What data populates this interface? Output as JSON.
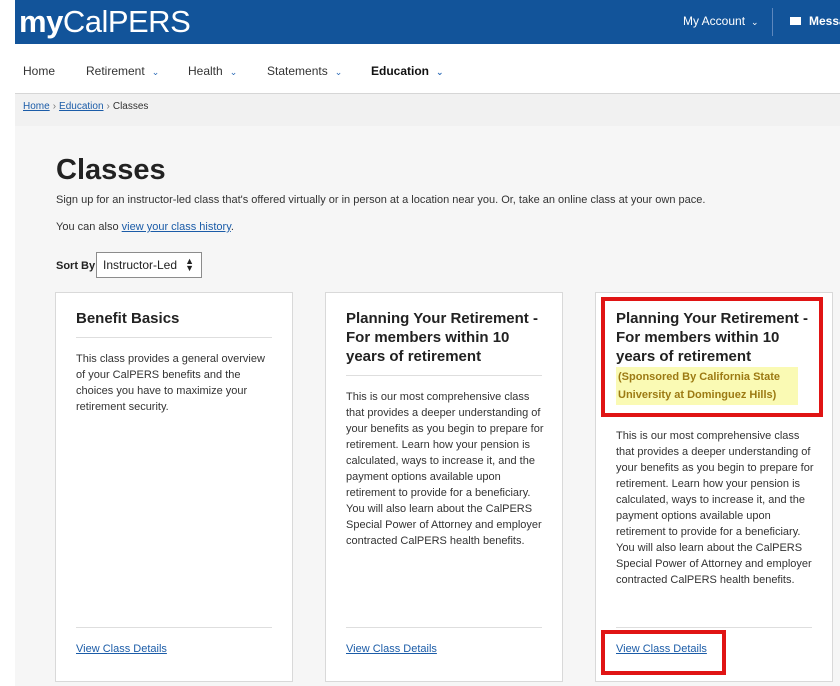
{
  "header": {
    "logo_my": "my",
    "logo_calpers": "CalPERS",
    "account_label": "My Account",
    "messages_label": "Messa"
  },
  "nav": {
    "items": [
      {
        "label": "Home",
        "has_dropdown": false
      },
      {
        "label": "Retirement",
        "has_dropdown": true
      },
      {
        "label": "Health",
        "has_dropdown": true
      },
      {
        "label": "Statements",
        "has_dropdown": true
      },
      {
        "label": "Education",
        "has_dropdown": true,
        "active": true
      }
    ]
  },
  "breadcrumb": {
    "items": [
      "Home",
      "Education",
      "Classes"
    ],
    "separator": "›"
  },
  "page": {
    "title": "Classes",
    "intro": "Sign up for an instructor-led class that's offered virtually or in person at a location near you. Or, take an online class at your own pace.",
    "history_prefix": "You can also ",
    "history_link": "view your class history",
    "history_suffix": "."
  },
  "sort": {
    "label": "Sort By",
    "selected": "Instructor-Led"
  },
  "cards": [
    {
      "title": "Benefit Basics",
      "description": "This class provides a general overview of your CalPERS benefits and the choices you have to maximize your retirement security.",
      "link": "View Class Details"
    },
    {
      "title": "Planning Your Retirement - For members within 10 years of retirement",
      "description": "This is our most comprehensive class that provides a deeper understanding of your benefits as you begin to prepare for retirement. Learn how your pension is calculated, ways to increase it, and the payment options available upon retirement to provide for a beneficiary. You will also learn about the CalPERS Special Power of Attorney and employer contracted CalPERS health benefits.",
      "link": "View Class Details"
    },
    {
      "title": "Planning Your Retirement - For members within 10 years of retirement",
      "sponsor": "(Sponsored By California State University at Dominguez Hills)",
      "description": "This is our most comprehensive class that provides a deeper understanding of your benefits as you begin to prepare for retirement. Learn how your pension is calculated, ways to increase it, and the payment options available upon retirement to provide for a beneficiary. You will also learn about the CalPERS Special Power of Attorney and employer contracted CalPERS health benefits.",
      "link": "View Class Details"
    }
  ],
  "icons": {
    "dropdown": "chevron-down-icon",
    "messages": "envelope-icon",
    "select": "up-down-arrows-icon"
  },
  "colors": {
    "header_bg": "#12549a",
    "link": "#1b5ca8",
    "highlight_border": "#e01414",
    "sponsor_bg": "#fafab4",
    "sponsor_text": "#9c7a13"
  }
}
